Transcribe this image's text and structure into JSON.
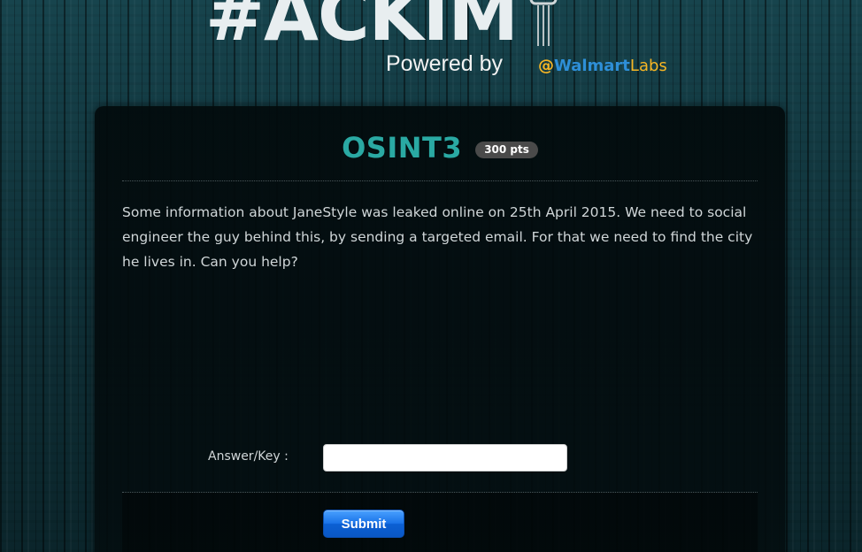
{
  "header": {
    "logo_text": "#ACKIM",
    "powered_by": "Powered by",
    "sponsor_at": "@",
    "sponsor_walmart": "Walmart",
    "sponsor_labs": "Labs"
  },
  "challenge": {
    "title": "OSINT3",
    "points": "300 pts",
    "description": "Some information about JaneStyle was leaked online on 25th April 2015. We need to social engineer the guy behind this, by sending a targeted email. For that we need to find the city he lives in. Can you help?"
  },
  "form": {
    "answer_label": "Answer/Key :",
    "answer_value": "",
    "submit_label": "Submit"
  },
  "colors": {
    "title": "#2aa9a3",
    "background": "#0f3038",
    "button": "#1a73e8",
    "walmart_blue": "#2e8fd8",
    "walmart_yellow": "#f7b624"
  }
}
